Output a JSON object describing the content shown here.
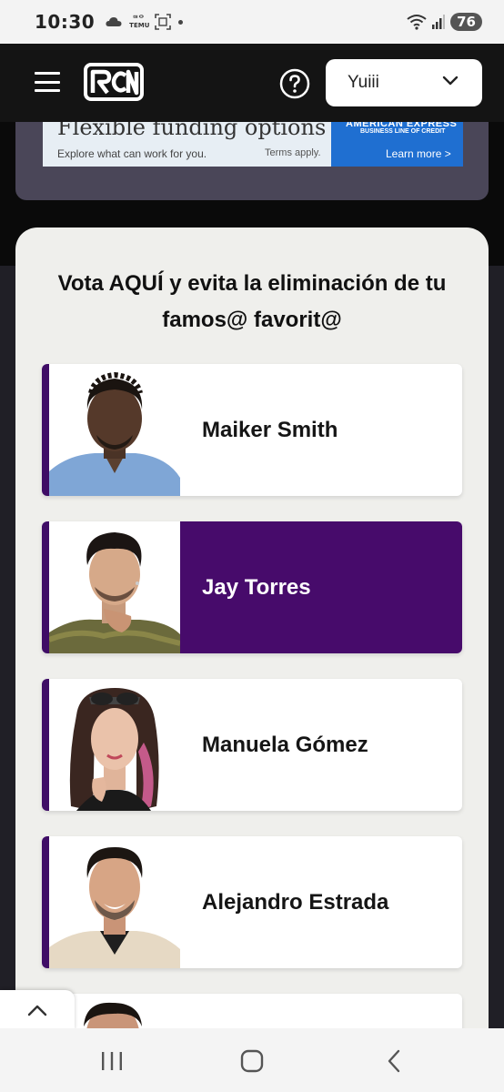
{
  "status_bar": {
    "time": "10:30",
    "notif_temu_top": "ᄃᄆᄋ",
    "notif_temu": "TEMU",
    "battery": "76"
  },
  "header": {
    "logo": "RCN",
    "profile_name": "Yuiii"
  },
  "ad": {
    "headline": "Flexible funding options",
    "subtext": "Explore what can work for you.",
    "terms": "Terms apply.",
    "brand": "AMERICAN EXPRESS",
    "brand_sub": "BUSINESS LINE OF CREDIT",
    "cta": "Learn more >"
  },
  "vote": {
    "title": "Vota AQUÍ y evita la eliminación de tu famos@ favorit@",
    "candidates": [
      {
        "name": "Maiker Smith",
        "selected": false
      },
      {
        "name": "Jay Torres",
        "selected": true
      },
      {
        "name": "Manuela Gómez",
        "selected": false
      },
      {
        "name": "Alejandro Estrada",
        "selected": false
      }
    ]
  },
  "icons": {
    "menu": "hamburger-icon",
    "help": "help-circle-icon",
    "dropdown": "chevron-down-icon",
    "collapse": "chevron-up-icon",
    "nav_recents": "recents-icon",
    "nav_home": "home-icon",
    "nav_back": "back-icon"
  },
  "colors": {
    "accent_purple": "#470b6b",
    "header_bg": "#141414",
    "card_bg": "#efefec"
  }
}
